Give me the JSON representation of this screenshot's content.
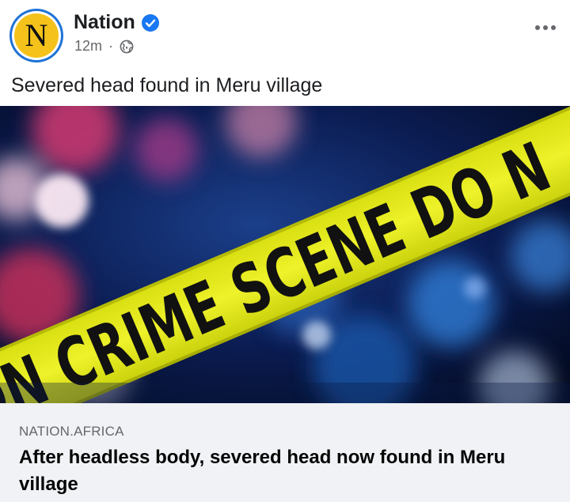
{
  "post": {
    "page_name": "Nation",
    "avatar_letter": "N",
    "time_ago": "12m",
    "separator": "·",
    "audience_icon": "globe-icon",
    "more_icon": "more-options-icon",
    "verified_icon": "verified-badge-icon",
    "caption": "Severed head found in Meru village"
  },
  "media": {
    "tape_text": "DN CRIME SCENE DO N"
  },
  "link_card": {
    "domain": "NATION.AFRICA",
    "title": "After headless body, severed head now found in Meru village"
  },
  "colors": {
    "brand_blue": "#1e73d6",
    "avatar_yellow": "#f4c21a",
    "tape_yellow": "#e7ec1c",
    "card_bg": "#f0f2f5",
    "text_primary": "#1c1e21",
    "text_secondary": "#65676b"
  }
}
